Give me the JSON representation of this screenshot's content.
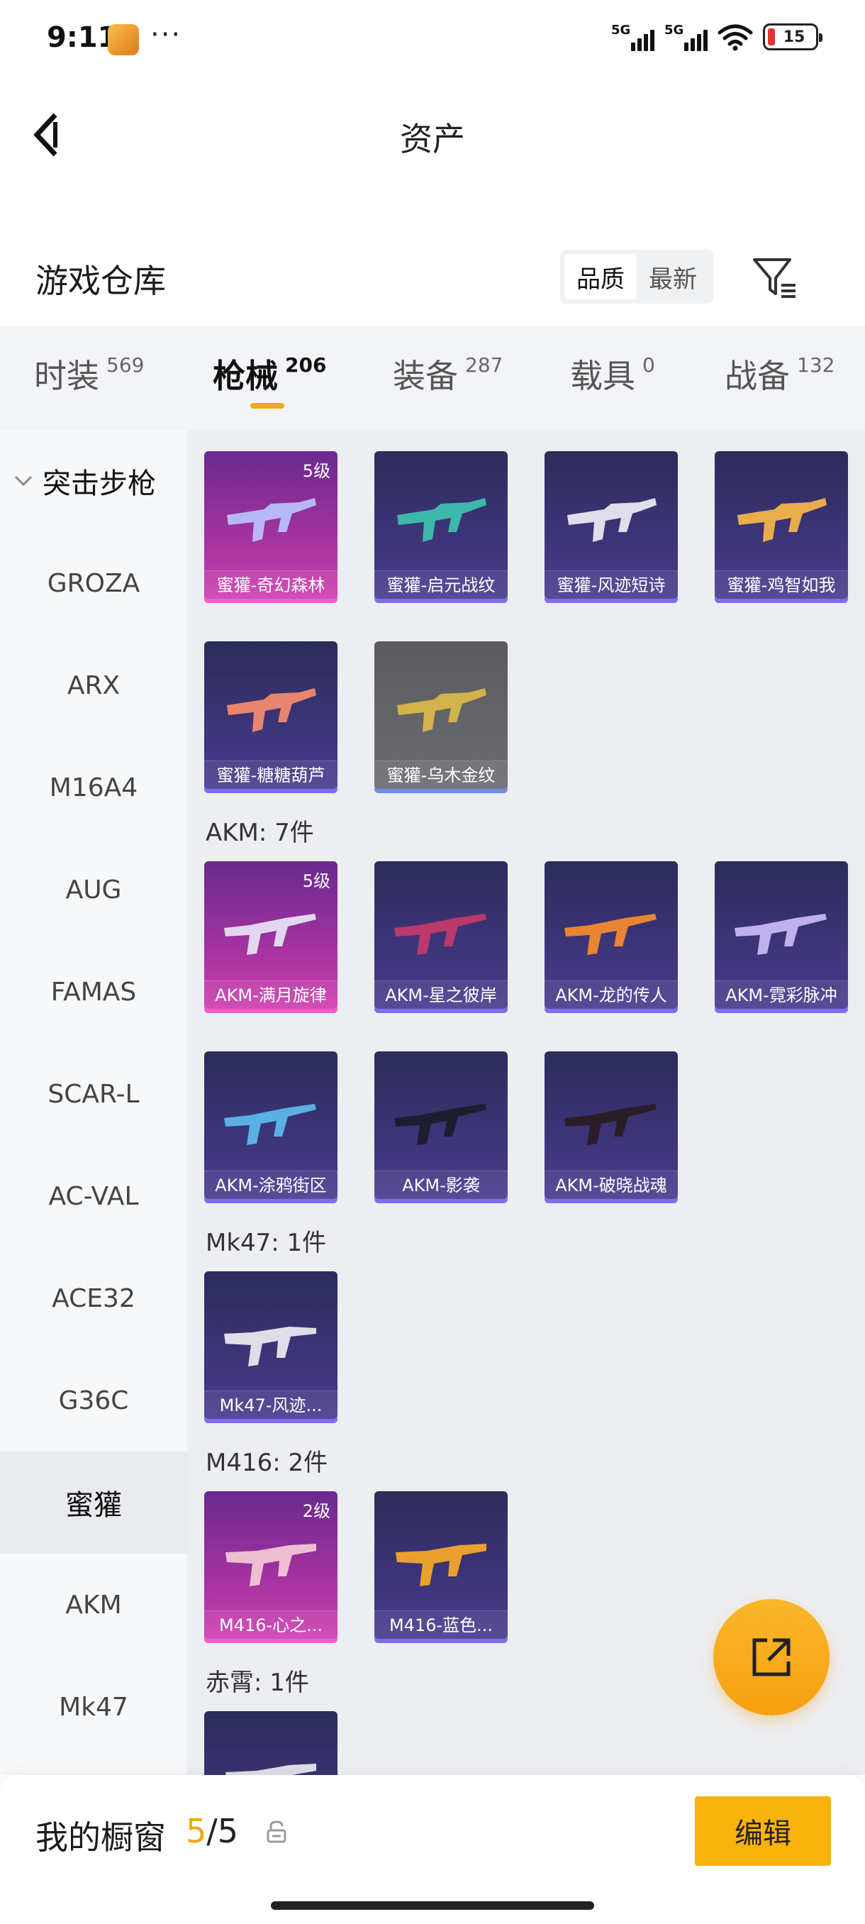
{
  "status_bar": {
    "time": "9:11",
    "network_1": "5G",
    "network_2": "5G",
    "battery": "15",
    "battery_color": "#e43434"
  },
  "header": {
    "title": "资产",
    "back_icon": "chevron-left-icon"
  },
  "warehouse": {
    "title": "游戏仓库",
    "sort_options": [
      "品质",
      "最新"
    ],
    "sort_selected": "品质",
    "filter_icon": "filter-icon"
  },
  "tabs": [
    {
      "label": "时装",
      "count": "569"
    },
    {
      "label": "枪械",
      "count": "206",
      "active": true
    },
    {
      "label": "装备",
      "count": "287"
    },
    {
      "label": "载具",
      "count": "0"
    },
    {
      "label": "战备",
      "count": "132"
    }
  ],
  "sidebar": {
    "group": "突击步枪",
    "items": [
      "GROZA",
      "ARX",
      "M16A4",
      "AUG",
      "FAMAS",
      "SCAR-L",
      "AC-VAL",
      "ACE32",
      "G36C",
      "蜜獾",
      "AKM",
      "Mk47"
    ],
    "selected": "蜜獾"
  },
  "sections": [
    {
      "title": "",
      "items": [
        {
          "label": "蜜獾-奇幻森林",
          "level": "5级",
          "rarity": "pink"
        },
        {
          "label": "蜜獾-启元战纹",
          "rarity": "purple"
        },
        {
          "label": "蜜獾-风迹短诗",
          "rarity": "purple"
        },
        {
          "label": "蜜獾-鸡智如我",
          "rarity": "purple"
        },
        {
          "label": "蜜獾-糖糖葫芦",
          "rarity": "purple"
        },
        {
          "label": "蜜獾-乌木金纹",
          "rarity": "grey"
        }
      ]
    },
    {
      "title": "AKM: 7件",
      "items": [
        {
          "label": "AKM-满月旋律",
          "level": "5级",
          "rarity": "pink"
        },
        {
          "label": "AKM-星之彼岸",
          "rarity": "purple"
        },
        {
          "label": "AKM-龙的传人",
          "rarity": "purple"
        },
        {
          "label": "AKM-霓彩脉冲",
          "rarity": "purple"
        },
        {
          "label": "AKM-涂鸦街区",
          "rarity": "purple"
        },
        {
          "label": "AKM-影袭",
          "rarity": "purple"
        },
        {
          "label": "AKM-破晓战魂",
          "rarity": "purple"
        }
      ]
    },
    {
      "title": "Mk47: 1件",
      "items": [
        {
          "label": "Mk47-风迹...",
          "rarity": "purple"
        }
      ]
    },
    {
      "title": "M416: 2件",
      "items": [
        {
          "label": "M416-心之...",
          "level": "2级",
          "rarity": "pink"
        },
        {
          "label": "M416-蓝色...",
          "rarity": "purple"
        }
      ]
    },
    {
      "title": "赤霄: 1件",
      "items": [
        {
          "label": "",
          "rarity": "purple"
        }
      ]
    }
  ],
  "fab": {
    "icon": "share-icon"
  },
  "bottom_bar": {
    "title": "我的橱窗",
    "count_current": "5",
    "count_sep": "/",
    "count_total": "5",
    "lock_icon": "lock-icon",
    "edit_label": "编辑",
    "accent": "#f8b30c"
  }
}
